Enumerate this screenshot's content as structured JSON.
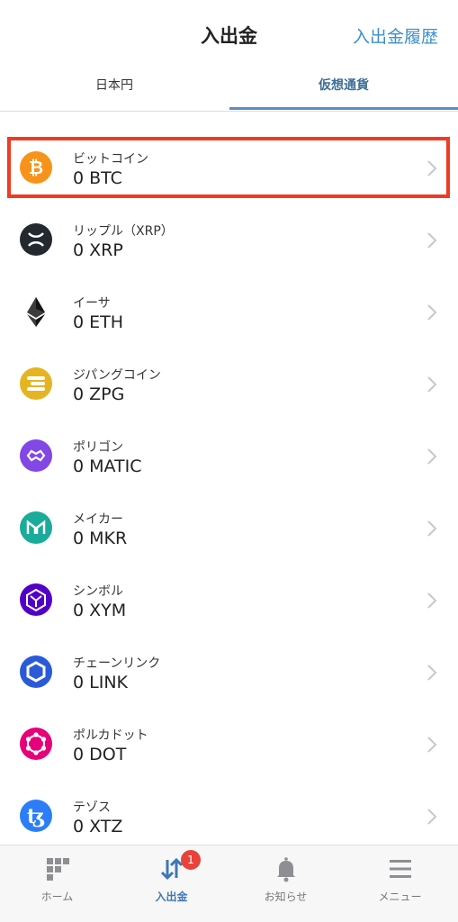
{
  "header": {
    "title": "入出金",
    "history_link": "入出金履歴"
  },
  "tabs": [
    {
      "label": "日本円",
      "active": false
    },
    {
      "label": "仮想通貨",
      "active": true
    }
  ],
  "coins": [
    {
      "name": "ビットコイン",
      "amount": "0 BTC",
      "icon": "bitcoin-icon",
      "color": "#f7931a"
    },
    {
      "name": "リップル（XRP）",
      "amount": "0 XRP",
      "icon": "xrp-icon",
      "color": "#23292f"
    },
    {
      "name": "イーサ",
      "amount": "0 ETH",
      "icon": "ethereum-icon",
      "color": "#3c3c3d"
    },
    {
      "name": "ジパングコイン",
      "amount": "0 ZPG",
      "icon": "zipangcoin-icon",
      "color": "#e6b422"
    },
    {
      "name": "ポリゴン",
      "amount": "0 MATIC",
      "icon": "polygon-icon",
      "color": "#8247e5"
    },
    {
      "name": "メイカー",
      "amount": "0 MKR",
      "icon": "maker-icon",
      "color": "#1aab9b"
    },
    {
      "name": "シンボル",
      "amount": "0 XYM",
      "icon": "symbol-icon",
      "color": "#5200c6"
    },
    {
      "name": "チェーンリンク",
      "amount": "0 LINK",
      "icon": "chainlink-icon",
      "color": "#2a5ada"
    },
    {
      "name": "ポルカドット",
      "amount": "0 DOT",
      "icon": "polkadot-icon",
      "color": "#e6007a"
    },
    {
      "name": "テゾス",
      "amount": "0 XTZ",
      "icon": "tezos-icon",
      "color": "#2c7df7"
    }
  ],
  "tabbar": {
    "home": "ホーム",
    "deposit": "入出金",
    "deposit_badge": "1",
    "notices": "お知らせ",
    "menu": "メニュー"
  },
  "colors": {
    "accent": "#3d8fcc",
    "highlight": "#ef3b24",
    "badge": "#e8423a"
  }
}
